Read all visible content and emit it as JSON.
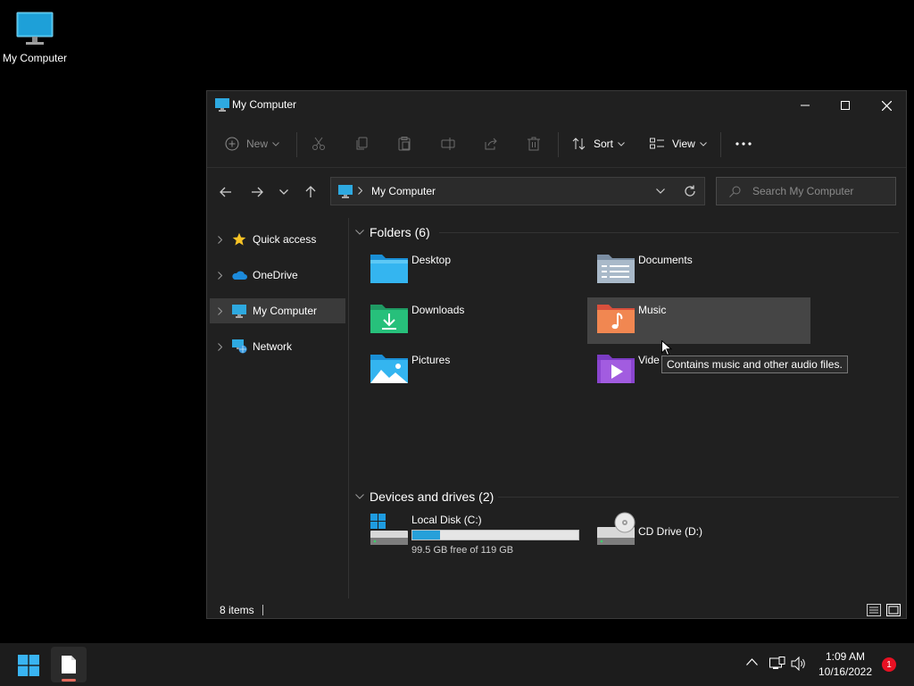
{
  "desktop": {
    "icon_label": "My Computer"
  },
  "window": {
    "title": "My Computer",
    "controls": [
      "minimize",
      "maximize",
      "close"
    ]
  },
  "toolbar": {
    "new_label": "New",
    "sort_label": "Sort",
    "view_label": "View",
    "icons": [
      "cut-icon",
      "copy-icon",
      "paste-icon",
      "rename-icon",
      "share-icon",
      "delete-icon",
      "more-icon"
    ]
  },
  "navigation": {
    "address": "My Computer",
    "search_placeholder": "Search My Computer"
  },
  "sidebar": {
    "items": [
      {
        "label": "Quick access",
        "icon": "star-icon"
      },
      {
        "label": "OneDrive",
        "icon": "cloud-icon"
      },
      {
        "label": "My Computer",
        "icon": "monitor-icon",
        "selected": true
      },
      {
        "label": "Network",
        "icon": "network-icon"
      }
    ]
  },
  "folders": {
    "header": "Folders (6)",
    "items": [
      {
        "name": "Desktop",
        "icon": "desktop-folder-icon"
      },
      {
        "name": "Documents",
        "icon": "documents-folder-icon"
      },
      {
        "name": "Downloads",
        "icon": "downloads-folder-icon"
      },
      {
        "name": "Music",
        "icon": "music-folder-icon",
        "hovered": true
      },
      {
        "name": "Pictures",
        "icon": "pictures-folder-icon"
      },
      {
        "name": "Videos",
        "display": "Vide",
        "icon": "videos-folder-icon"
      }
    ]
  },
  "drives": {
    "header": "Devices and drives (2)",
    "items": [
      {
        "name": "Local Disk (C:)",
        "free_text": "99.5 GB free of 119 GB",
        "used_fraction": 0.164
      },
      {
        "name": "CD Drive (D:)"
      }
    ]
  },
  "tooltip": "Contains music and other audio files.",
  "status": {
    "item_count": "8 items"
  },
  "taskbar": {
    "time": "1:09 AM",
    "date": "10/16/2022",
    "notification_count": "1"
  },
  "colors": {
    "accent": "#26a0da",
    "window_bg": "#202020",
    "taskbar_bg": "#1c1c1c",
    "badge": "#e81123"
  }
}
